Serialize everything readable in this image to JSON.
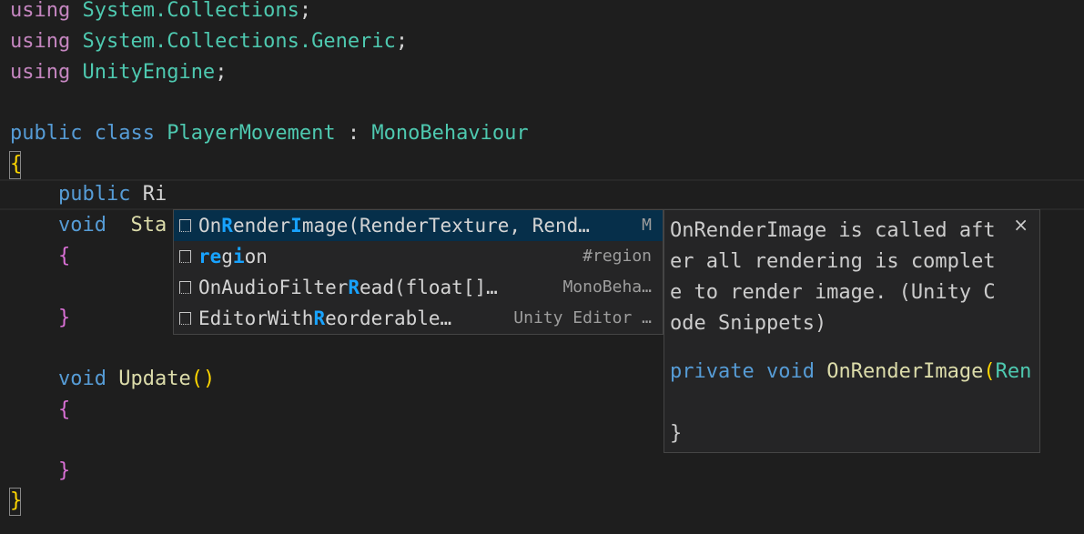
{
  "code": {
    "line1": {
      "kw": "using",
      "ns": "System.Collections",
      "end": ";"
    },
    "line2": {
      "kw": "using",
      "ns": "System.Collections.Generic",
      "end": ";"
    },
    "line3": {
      "kw": "using",
      "ns": "UnityEngine",
      "end": ";"
    },
    "line5": {
      "kw1": "public",
      "kw2": "class",
      "cls": "PlayerMovement",
      "colon": ":",
      "base": "MonoBehaviour"
    },
    "open_brace": "{",
    "line7": {
      "kw": "public",
      "typed": "Ri"
    },
    "line8": {
      "kw": "void",
      "name": "Sta"
    },
    "brace": "{",
    "close_brace": "}",
    "line12": {
      "kw": "void",
      "name": "Update",
      "parens": "()"
    }
  },
  "suggest": {
    "items": [
      {
        "pre": "On",
        "h1": "R",
        "mid": "ender",
        "h2": "I",
        "post": "mage(RenderTexture, Rend…",
        "detail": "M"
      },
      {
        "pre": "",
        "h1": "re",
        "mid": "g",
        "h2": "i",
        "post": "on",
        "detail": "#region"
      },
      {
        "pre": "OnAudioFilter",
        "h1": "R",
        "mid": "ead(float[]…",
        "h2": "",
        "post": "",
        "detail": "MonoBeha…"
      },
      {
        "pre": "EditorWith",
        "h1": "R",
        "mid": "eorderable…",
        "h2": "",
        "post": "",
        "detail": "Unity Editor …"
      }
    ]
  },
  "details": {
    "doc_lines": [
      "OnRenderImage is called aft",
      "er all rendering is complet",
      "e to render image. (Unity C",
      "ode Snippets)"
    ],
    "code_kw1": "private",
    "code_kw2": "void",
    "code_fn": "OnRenderImage",
    "code_paren": "(",
    "code_type": "Ren",
    "code_close": "}",
    "close_label": "×"
  }
}
